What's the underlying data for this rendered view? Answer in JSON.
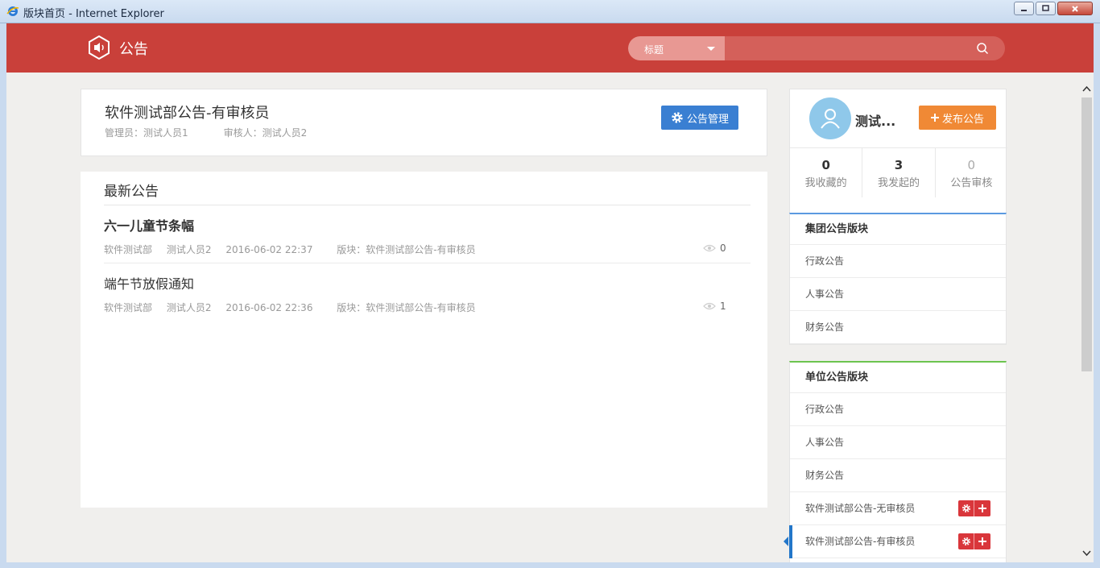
{
  "window": {
    "title": "版块首页 - Internet Explorer"
  },
  "header": {
    "app_title": "公告",
    "search": {
      "scope": "标题",
      "placeholder": ""
    }
  },
  "board": {
    "title": "软件测试部公告-有审核员",
    "admin": "管理员：测试人员1",
    "reviewer": "审核人：测试人员2",
    "manage_label": "公告管理"
  },
  "latest": {
    "heading": "最新公告",
    "items": [
      {
        "title": "六一儿童节条幅",
        "dept": "软件测试部",
        "author": "测试人员2",
        "time": "2016-06-02 22:37",
        "board": "版块：软件测试部公告-有审核员",
        "views": "0"
      },
      {
        "title": "端午节放假通知",
        "dept": "软件测试部",
        "author": "测试人员2",
        "time": "2016-06-02 22:36",
        "board": "版块：软件测试部公告-有审核员",
        "views": "1"
      }
    ]
  },
  "profile": {
    "name": "测试...",
    "publish_label": "发布公告",
    "stats": [
      {
        "value": "0",
        "label": "我收藏的"
      },
      {
        "value": "3",
        "label": "我发起的"
      },
      {
        "value": "0",
        "label": "公告审核"
      }
    ]
  },
  "group_boards": {
    "title": "集团公告版块",
    "items": [
      "行政公告",
      "人事公告",
      "财务公告"
    ]
  },
  "unit_boards": {
    "title": "单位公告版块",
    "items": [
      "行政公告",
      "人事公告",
      "财务公告",
      "软件测试部公告-无审核员",
      "软件测试部公告-有审核员"
    ]
  },
  "colors": {
    "header": "#c9403a",
    "manage_button": "#3a7fd2",
    "publish_button": "#f08935",
    "group_accent": "#5b9ae0",
    "unit_accent": "#6cc44e",
    "active_marker": "#2276c9"
  }
}
